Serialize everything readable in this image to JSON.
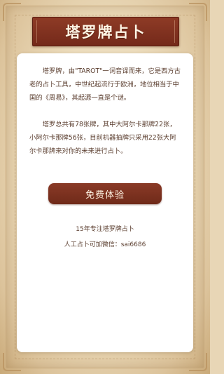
{
  "header": {
    "title": "塔罗牌占卜"
  },
  "intro": {
    "paragraph_1": "塔罗牌，由\"TAROT\"一词音译而来，它是西方古老的占卜工具，中世纪起流行于欧洲，地位相当于中国的《周易》，其起源一直是个谜。",
    "paragraph_2": "塔罗总共有78张牌，其中大阿尔卡那牌22张，小阿尔卡那牌56张，目前机器抽牌只采用22张大阿尔卡那牌来对你的未来进行占卜。"
  },
  "cta": {
    "label": "免费体验"
  },
  "footer": {
    "tagline": "15年专注塔罗牌占卜",
    "contact": "人工占卜可加微信：sai6686"
  },
  "colors": {
    "accent": "#7e321f",
    "text": "#5a3d2e",
    "background": "#ecdcbc"
  }
}
